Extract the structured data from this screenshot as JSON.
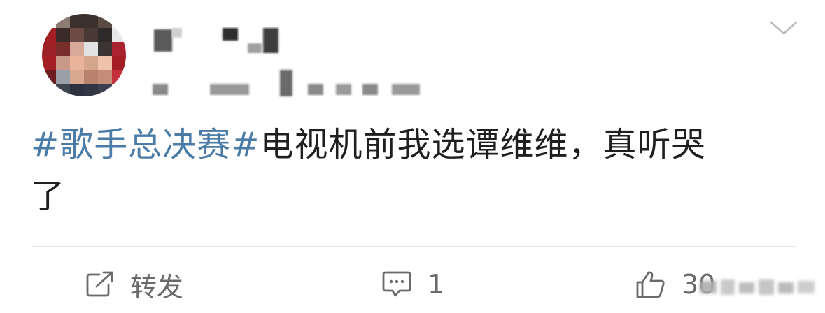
{
  "post": {
    "avatar_icon": "pixelated-avatar",
    "username": "",
    "meta": "",
    "menu_icon": "chevron-down-icon",
    "topic": "#歌手总决赛#",
    "body_line1": "电视机前我选谭维维，真听哭",
    "body_line2": "了"
  },
  "actions": {
    "repost": {
      "icon": "share-icon",
      "label": "转发"
    },
    "comment": {
      "icon": "comment-icon",
      "count": "1"
    },
    "like": {
      "icon": "thumbs-up-icon",
      "count": "30"
    }
  },
  "colors": {
    "topic": "#4b7ba7",
    "text": "#1f1f1f",
    "action": "#6a6a6a",
    "divider": "#e8e8e8"
  }
}
